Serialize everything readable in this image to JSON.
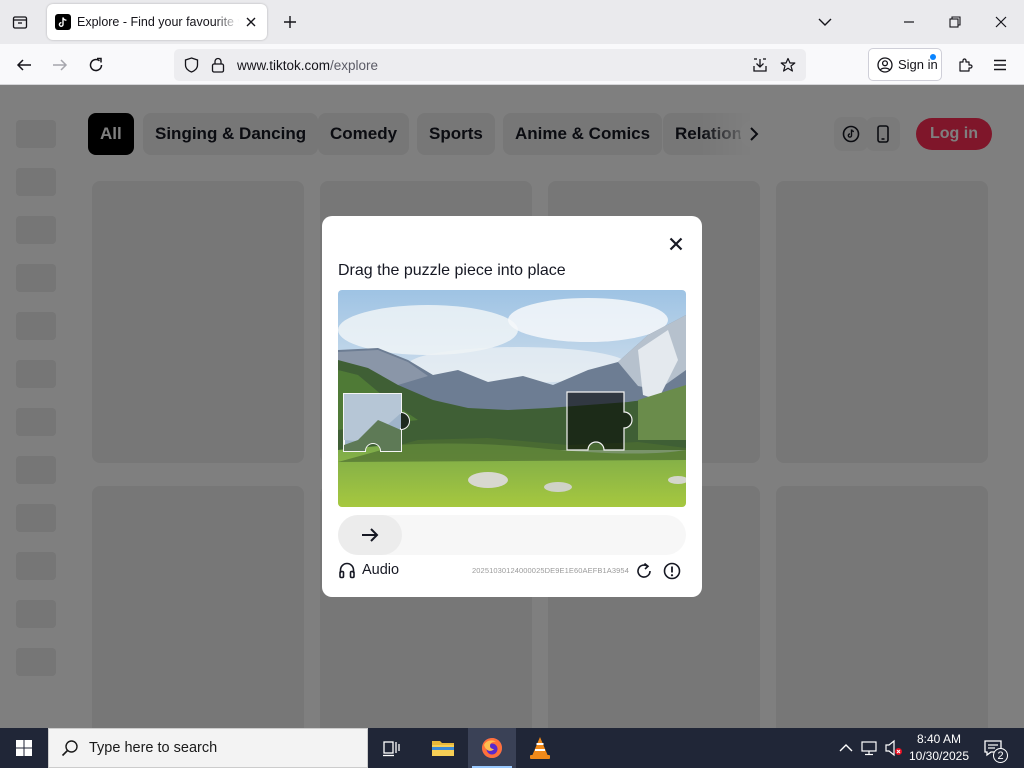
{
  "browser": {
    "tab": {
      "title": "Explore - Find your favourite videos on TikTok"
    },
    "address": {
      "host": "www.tiktok.com",
      "path": "/explore"
    },
    "signin_label": "Sign in"
  },
  "page": {
    "categories": [
      "All",
      "Singing & Dancing",
      "Comedy",
      "Sports",
      "Anime & Comics",
      "Relation"
    ],
    "active_category": "All",
    "login_label": "Log in",
    "colors": {
      "login": "#fe2c55",
      "chip_active": "#000000"
    }
  },
  "captcha": {
    "title": "Drag the puzzle piece into place",
    "audio_label": "Audio",
    "id": "20251030124000025DE9E1E60AEFB1A3954",
    "slider_progress": 0
  },
  "taskbar": {
    "search_placeholder": "Type here to search",
    "time": "8:40 AM",
    "date": "10/30/2025",
    "notification_count": "2"
  }
}
